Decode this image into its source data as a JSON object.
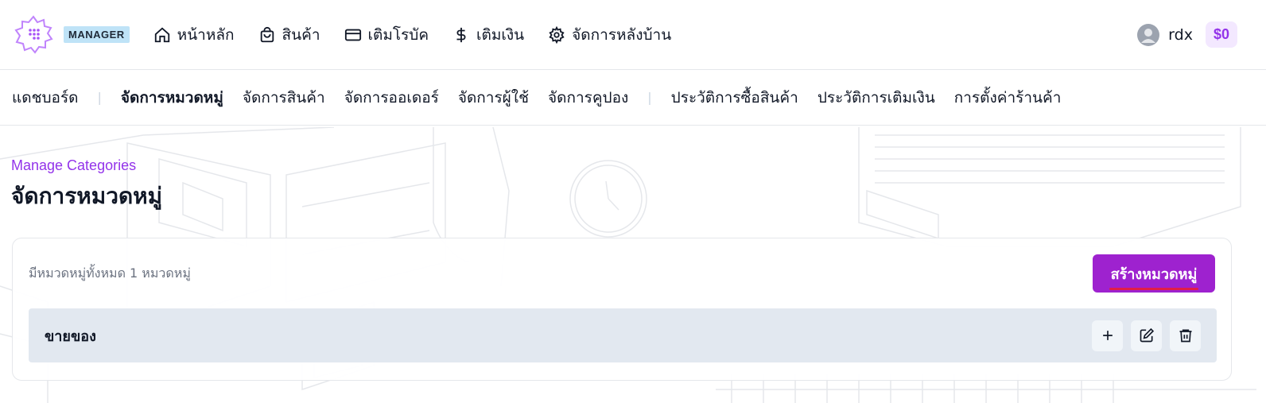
{
  "topbar": {
    "badge": "MANAGER",
    "nav": [
      {
        "label": "หน้าหลัก",
        "icon": "home-icon"
      },
      {
        "label": "สินค้า",
        "icon": "shopping-bag-icon"
      },
      {
        "label": "เติมโรบัค",
        "icon": "credit-card-icon"
      },
      {
        "label": "เติมเงิน",
        "icon": "dollar-icon"
      },
      {
        "label": "จัดการหลังบ้าน",
        "icon": "gear-icon"
      }
    ],
    "username": "rdx",
    "balance": "$0"
  },
  "subnav": {
    "items": [
      {
        "label": "แดชบอร์ด"
      },
      {
        "label": "จัดการหมวดหมู่"
      },
      {
        "label": "จัดการสินค้า"
      },
      {
        "label": "จัดการออเดอร์"
      },
      {
        "label": "จัดการผู้ใช้"
      },
      {
        "label": "จัดการคูปอง"
      },
      {
        "label": "ประวัติการซื้อสินค้า"
      },
      {
        "label": "ประวัติการเติมเงิน"
      },
      {
        "label": "การตั้งค่าร้านค้า"
      }
    ],
    "active_index": 1
  },
  "page": {
    "subtitle": "Manage Categories",
    "title": "จัดการหมวดหมู่"
  },
  "card": {
    "count_text": "มีหมวดหมู่ทั้งหมด 1 หมวดหมู่",
    "create_button": "สร้างหมวดหมู่",
    "categories": [
      {
        "name": "ขายของ"
      }
    ]
  },
  "colors": {
    "accent": "#9333ea",
    "button": "#9e22cf",
    "badge_bg": "#bfe3f7",
    "row_bg": "#e2e8f0"
  }
}
